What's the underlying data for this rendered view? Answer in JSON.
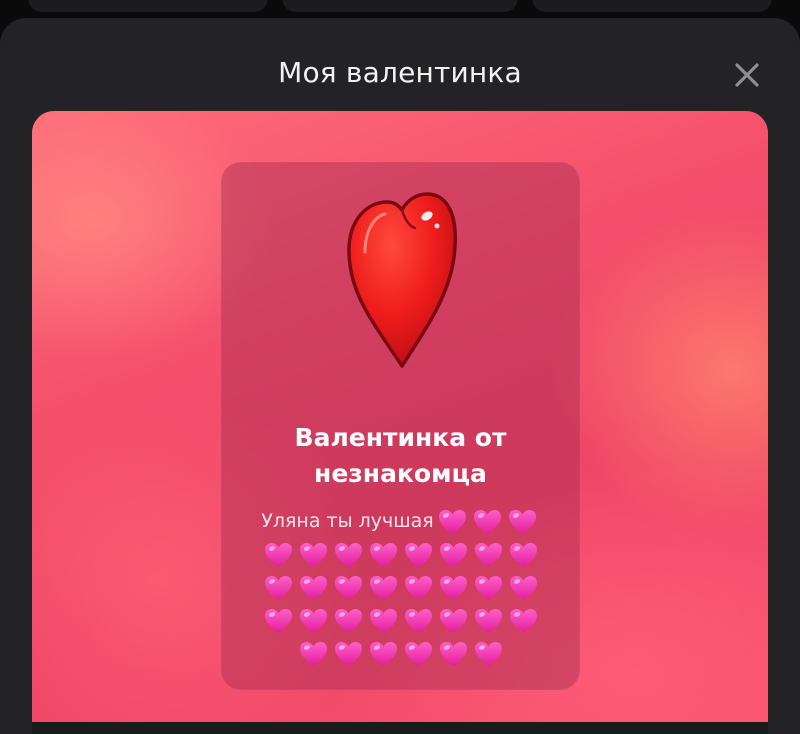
{
  "header": {
    "title": "Моя валентинка"
  },
  "card": {
    "title_line1": "Валентинка от",
    "title_line2": "незнакомца",
    "message_text": "Уляна ты лучшая",
    "heart_icon": "pink-heart-icon",
    "sticker_icon": "red-heart-sticker-icon",
    "accent_color": "#f4506c"
  }
}
